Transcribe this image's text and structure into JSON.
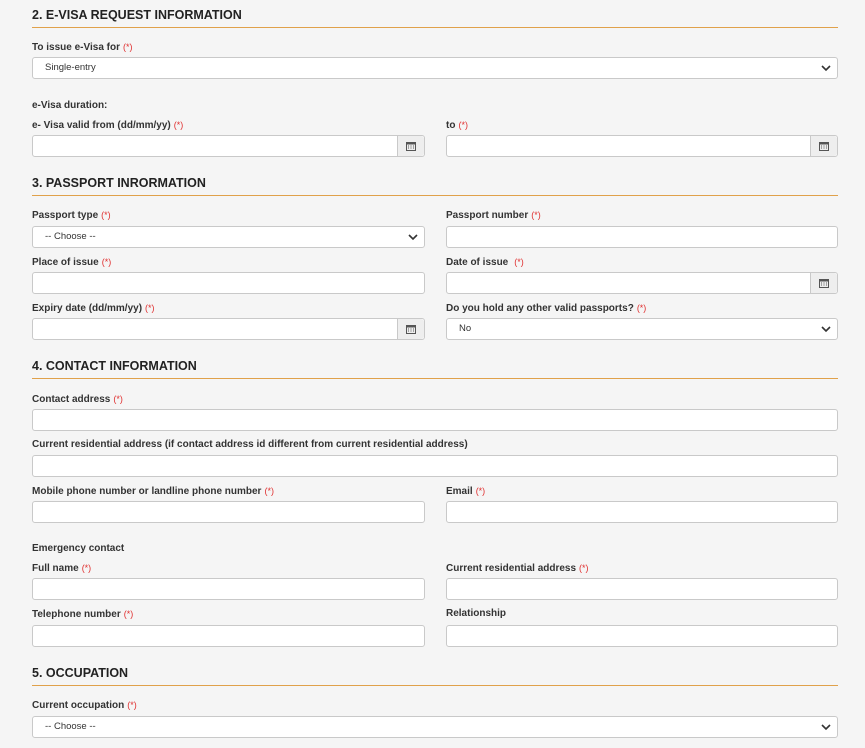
{
  "required_mark": "(*)",
  "section2": {
    "title": "2. E-VISA REQUEST INFORMATION",
    "issue_for_label": "To issue e-Visa for",
    "issue_for_value": "Single-entry",
    "duration_label": "e-Visa duration:",
    "valid_from_label": "e- Visa valid from (dd/mm/yy)",
    "to_label": "to"
  },
  "section3": {
    "title": "3. PASSPORT INRORMATION",
    "passport_type_label": "Passport type",
    "passport_type_value": "-- Choose --",
    "passport_number_label": "Passport number",
    "place_of_issue_label": "Place of issue",
    "date_of_issue_label": "Date of issue",
    "expiry_label": "Expiry date (dd/mm/yy)",
    "other_passports_label": "Do you hold any other valid passports?",
    "other_passports_value": "No"
  },
  "section4": {
    "title": "4. CONTACT INFORMATION",
    "contact_address_label": "Contact address",
    "current_residential_label": "Current residential address (if contact address id different from current residential address)",
    "phone_label": "Mobile phone number or landline phone number",
    "email_label": "Email",
    "emergency_label": "Emergency contact",
    "full_name_label": "Full name",
    "emergency_residential_label": "Current residential address",
    "telephone_label": "Telephone number",
    "relationship_label": "Relationship"
  },
  "section5": {
    "title": "5. OCCUPATION",
    "occupation_label": "Current occupation",
    "occupation_value": "-- Choose --"
  },
  "colors": {
    "accent": "#e0a14a",
    "required": "#e03030"
  }
}
